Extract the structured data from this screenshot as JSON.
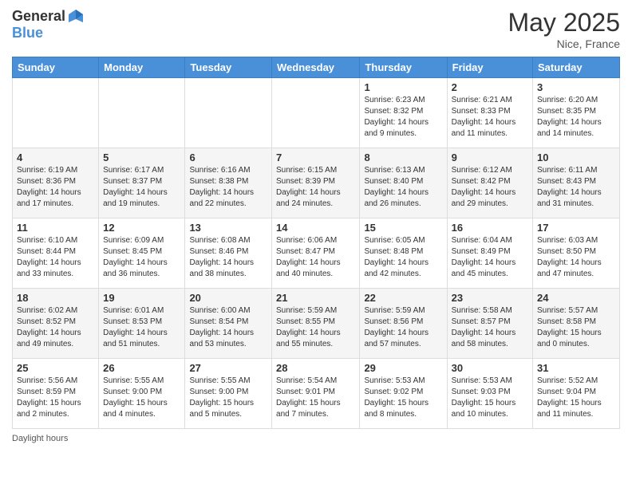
{
  "header": {
    "logo_general": "General",
    "logo_blue": "Blue",
    "month_title": "May 2025",
    "location": "Nice, France"
  },
  "days_of_week": [
    "Sunday",
    "Monday",
    "Tuesday",
    "Wednesday",
    "Thursday",
    "Friday",
    "Saturday"
  ],
  "footer": {
    "daylight_label": "Daylight hours"
  },
  "weeks": [
    [
      {
        "day": "",
        "sunrise": "",
        "sunset": "",
        "daylight": ""
      },
      {
        "day": "",
        "sunrise": "",
        "sunset": "",
        "daylight": ""
      },
      {
        "day": "",
        "sunrise": "",
        "sunset": "",
        "daylight": ""
      },
      {
        "day": "",
        "sunrise": "",
        "sunset": "",
        "daylight": ""
      },
      {
        "day": "1",
        "sunrise": "Sunrise: 6:23 AM",
        "sunset": "Sunset: 8:32 PM",
        "daylight": "Daylight: 14 hours and 9 minutes."
      },
      {
        "day": "2",
        "sunrise": "Sunrise: 6:21 AM",
        "sunset": "Sunset: 8:33 PM",
        "daylight": "Daylight: 14 hours and 11 minutes."
      },
      {
        "day": "3",
        "sunrise": "Sunrise: 6:20 AM",
        "sunset": "Sunset: 8:35 PM",
        "daylight": "Daylight: 14 hours and 14 minutes."
      }
    ],
    [
      {
        "day": "4",
        "sunrise": "Sunrise: 6:19 AM",
        "sunset": "Sunset: 8:36 PM",
        "daylight": "Daylight: 14 hours and 17 minutes."
      },
      {
        "day": "5",
        "sunrise": "Sunrise: 6:17 AM",
        "sunset": "Sunset: 8:37 PM",
        "daylight": "Daylight: 14 hours and 19 minutes."
      },
      {
        "day": "6",
        "sunrise": "Sunrise: 6:16 AM",
        "sunset": "Sunset: 8:38 PM",
        "daylight": "Daylight: 14 hours and 22 minutes."
      },
      {
        "day": "7",
        "sunrise": "Sunrise: 6:15 AM",
        "sunset": "Sunset: 8:39 PM",
        "daylight": "Daylight: 14 hours and 24 minutes."
      },
      {
        "day": "8",
        "sunrise": "Sunrise: 6:13 AM",
        "sunset": "Sunset: 8:40 PM",
        "daylight": "Daylight: 14 hours and 26 minutes."
      },
      {
        "day": "9",
        "sunrise": "Sunrise: 6:12 AM",
        "sunset": "Sunset: 8:42 PM",
        "daylight": "Daylight: 14 hours and 29 minutes."
      },
      {
        "day": "10",
        "sunrise": "Sunrise: 6:11 AM",
        "sunset": "Sunset: 8:43 PM",
        "daylight": "Daylight: 14 hours and 31 minutes."
      }
    ],
    [
      {
        "day": "11",
        "sunrise": "Sunrise: 6:10 AM",
        "sunset": "Sunset: 8:44 PM",
        "daylight": "Daylight: 14 hours and 33 minutes."
      },
      {
        "day": "12",
        "sunrise": "Sunrise: 6:09 AM",
        "sunset": "Sunset: 8:45 PM",
        "daylight": "Daylight: 14 hours and 36 minutes."
      },
      {
        "day": "13",
        "sunrise": "Sunrise: 6:08 AM",
        "sunset": "Sunset: 8:46 PM",
        "daylight": "Daylight: 14 hours and 38 minutes."
      },
      {
        "day": "14",
        "sunrise": "Sunrise: 6:06 AM",
        "sunset": "Sunset: 8:47 PM",
        "daylight": "Daylight: 14 hours and 40 minutes."
      },
      {
        "day": "15",
        "sunrise": "Sunrise: 6:05 AM",
        "sunset": "Sunset: 8:48 PM",
        "daylight": "Daylight: 14 hours and 42 minutes."
      },
      {
        "day": "16",
        "sunrise": "Sunrise: 6:04 AM",
        "sunset": "Sunset: 8:49 PM",
        "daylight": "Daylight: 14 hours and 45 minutes."
      },
      {
        "day": "17",
        "sunrise": "Sunrise: 6:03 AM",
        "sunset": "Sunset: 8:50 PM",
        "daylight": "Daylight: 14 hours and 47 minutes."
      }
    ],
    [
      {
        "day": "18",
        "sunrise": "Sunrise: 6:02 AM",
        "sunset": "Sunset: 8:52 PM",
        "daylight": "Daylight: 14 hours and 49 minutes."
      },
      {
        "day": "19",
        "sunrise": "Sunrise: 6:01 AM",
        "sunset": "Sunset: 8:53 PM",
        "daylight": "Daylight: 14 hours and 51 minutes."
      },
      {
        "day": "20",
        "sunrise": "Sunrise: 6:00 AM",
        "sunset": "Sunset: 8:54 PM",
        "daylight": "Daylight: 14 hours and 53 minutes."
      },
      {
        "day": "21",
        "sunrise": "Sunrise: 5:59 AM",
        "sunset": "Sunset: 8:55 PM",
        "daylight": "Daylight: 14 hours and 55 minutes."
      },
      {
        "day": "22",
        "sunrise": "Sunrise: 5:59 AM",
        "sunset": "Sunset: 8:56 PM",
        "daylight": "Daylight: 14 hours and 57 minutes."
      },
      {
        "day": "23",
        "sunrise": "Sunrise: 5:58 AM",
        "sunset": "Sunset: 8:57 PM",
        "daylight": "Daylight: 14 hours and 58 minutes."
      },
      {
        "day": "24",
        "sunrise": "Sunrise: 5:57 AM",
        "sunset": "Sunset: 8:58 PM",
        "daylight": "Daylight: 15 hours and 0 minutes."
      }
    ],
    [
      {
        "day": "25",
        "sunrise": "Sunrise: 5:56 AM",
        "sunset": "Sunset: 8:59 PM",
        "daylight": "Daylight: 15 hours and 2 minutes."
      },
      {
        "day": "26",
        "sunrise": "Sunrise: 5:55 AM",
        "sunset": "Sunset: 9:00 PM",
        "daylight": "Daylight: 15 hours and 4 minutes."
      },
      {
        "day": "27",
        "sunrise": "Sunrise: 5:55 AM",
        "sunset": "Sunset: 9:00 PM",
        "daylight": "Daylight: 15 hours and 5 minutes."
      },
      {
        "day": "28",
        "sunrise": "Sunrise: 5:54 AM",
        "sunset": "Sunset: 9:01 PM",
        "daylight": "Daylight: 15 hours and 7 minutes."
      },
      {
        "day": "29",
        "sunrise": "Sunrise: 5:53 AM",
        "sunset": "Sunset: 9:02 PM",
        "daylight": "Daylight: 15 hours and 8 minutes."
      },
      {
        "day": "30",
        "sunrise": "Sunrise: 5:53 AM",
        "sunset": "Sunset: 9:03 PM",
        "daylight": "Daylight: 15 hours and 10 minutes."
      },
      {
        "day": "31",
        "sunrise": "Sunrise: 5:52 AM",
        "sunset": "Sunset: 9:04 PM",
        "daylight": "Daylight: 15 hours and 11 minutes."
      }
    ]
  ]
}
